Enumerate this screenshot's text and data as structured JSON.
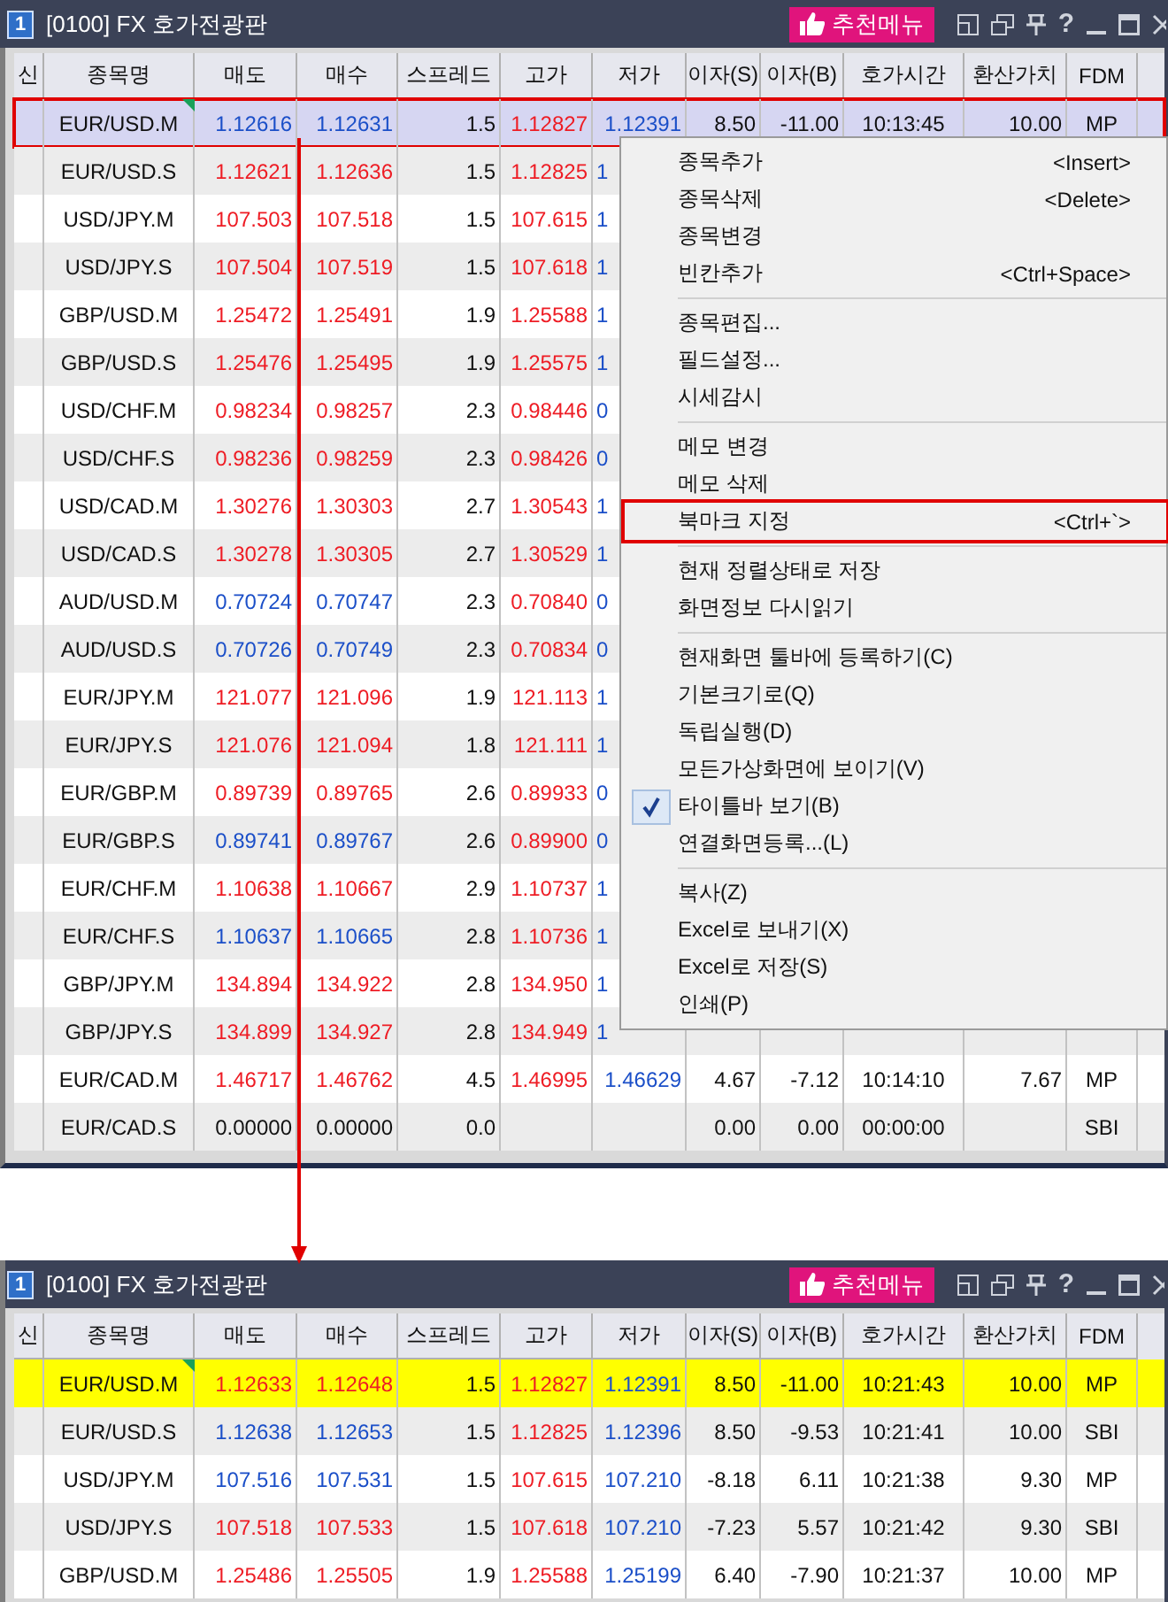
{
  "windows": [
    {
      "badge": "1",
      "title": "[0100] FX 호가전광판",
      "recommend": "추천메뉴",
      "help": "?",
      "columns": [
        "신",
        "종목명",
        "매도",
        "매수",
        "스프레드",
        "고가",
        "저가",
        "이자(S)",
        "이자(B)",
        "호가시간",
        "환산가치",
        "FDM"
      ],
      "rows": [
        {
          "selected": true,
          "bookmarked": false,
          "marked": true,
          "memo": true,
          "cells": [
            "",
            "EUR/USD.M",
            {
              "text": "1.12616",
              "color": "#1b4fc8"
            },
            {
              "text": "1.12631",
              "color": "#1b4fc8"
            },
            "1.5",
            {
              "text": "1.12827",
              "color": "#ee1c24"
            },
            {
              "text": "1.12391",
              "color": "#1b4fc8"
            },
            "8.50",
            "-11.00",
            "10:13:45",
            "10.00",
            "MP"
          ]
        },
        {
          "selected": false,
          "bookmarked": false,
          "marked": false,
          "memo": false,
          "cells": [
            "",
            "EUR/USD.S",
            {
              "text": "1.12621",
              "color": "#ee1c24"
            },
            {
              "text": "1.12636",
              "color": "#ee1c24"
            },
            "1.5",
            {
              "text": "1.12825",
              "color": "#ee1c24"
            },
            {
              "text": "1",
              "color": "#1b4fc8"
            }
          ]
        },
        {
          "selected": false,
          "bookmarked": false,
          "marked": false,
          "memo": false,
          "cells": [
            "",
            "USD/JPY.M",
            {
              "text": "107.503",
              "color": "#ee1c24"
            },
            {
              "text": "107.518",
              "color": "#ee1c24"
            },
            "1.5",
            {
              "text": "107.615",
              "color": "#ee1c24"
            },
            {
              "text": "1",
              "color": "#1b4fc8"
            }
          ]
        },
        {
          "selected": false,
          "bookmarked": false,
          "marked": false,
          "memo": false,
          "cells": [
            "",
            "USD/JPY.S",
            {
              "text": "107.504",
              "color": "#ee1c24"
            },
            {
              "text": "107.519",
              "color": "#ee1c24"
            },
            "1.5",
            {
              "text": "107.618",
              "color": "#ee1c24"
            },
            {
              "text": "1",
              "color": "#1b4fc8"
            }
          ]
        },
        {
          "selected": false,
          "bookmarked": false,
          "marked": false,
          "memo": false,
          "cells": [
            "",
            "GBP/USD.M",
            {
              "text": "1.25472",
              "color": "#ee1c24"
            },
            {
              "text": "1.25491",
              "color": "#ee1c24"
            },
            "1.9",
            {
              "text": "1.25588",
              "color": "#ee1c24"
            },
            {
              "text": "1",
              "color": "#1b4fc8"
            }
          ]
        },
        {
          "selected": false,
          "bookmarked": false,
          "marked": false,
          "memo": false,
          "cells": [
            "",
            "GBP/USD.S",
            {
              "text": "1.25476",
              "color": "#ee1c24"
            },
            {
              "text": "1.25495",
              "color": "#ee1c24"
            },
            "1.9",
            {
              "text": "1.25575",
              "color": "#ee1c24"
            },
            {
              "text": "1",
              "color": "#1b4fc8"
            }
          ]
        },
        {
          "selected": false,
          "bookmarked": false,
          "marked": false,
          "memo": false,
          "cells": [
            "",
            "USD/CHF.M",
            {
              "text": "0.98234",
              "color": "#ee1c24"
            },
            {
              "text": "0.98257",
              "color": "#ee1c24"
            },
            "2.3",
            {
              "text": "0.98446",
              "color": "#ee1c24"
            },
            {
              "text": "0",
              "color": "#1b4fc8"
            }
          ]
        },
        {
          "selected": false,
          "bookmarked": false,
          "marked": false,
          "memo": false,
          "cells": [
            "",
            "USD/CHF.S",
            {
              "text": "0.98236",
              "color": "#ee1c24"
            },
            {
              "text": "0.98259",
              "color": "#ee1c24"
            },
            "2.3",
            {
              "text": "0.98426",
              "color": "#ee1c24"
            },
            {
              "text": "0",
              "color": "#1b4fc8"
            }
          ]
        },
        {
          "selected": false,
          "bookmarked": false,
          "marked": false,
          "memo": false,
          "cells": [
            "",
            "USD/CAD.M",
            {
              "text": "1.30276",
              "color": "#ee1c24"
            },
            {
              "text": "1.30303",
              "color": "#ee1c24"
            },
            "2.7",
            {
              "text": "1.30543",
              "color": "#ee1c24"
            },
            {
              "text": "1",
              "color": "#1b4fc8"
            }
          ]
        },
        {
          "selected": false,
          "bookmarked": false,
          "marked": false,
          "memo": false,
          "cells": [
            "",
            "USD/CAD.S",
            {
              "text": "1.30278",
              "color": "#ee1c24"
            },
            {
              "text": "1.30305",
              "color": "#ee1c24"
            },
            "2.7",
            {
              "text": "1.30529",
              "color": "#ee1c24"
            },
            {
              "text": "1",
              "color": "#1b4fc8"
            }
          ]
        },
        {
          "selected": false,
          "bookmarked": false,
          "marked": false,
          "memo": false,
          "cells": [
            "",
            "AUD/USD.M",
            {
              "text": "0.70724",
              "color": "#1b4fc8"
            },
            {
              "text": "0.70747",
              "color": "#1b4fc8"
            },
            "2.3",
            {
              "text": "0.70840",
              "color": "#ee1c24"
            },
            {
              "text": "0",
              "color": "#1b4fc8"
            }
          ]
        },
        {
          "selected": false,
          "bookmarked": false,
          "marked": false,
          "memo": false,
          "cells": [
            "",
            "AUD/USD.S",
            {
              "text": "0.70726",
              "color": "#1b4fc8"
            },
            {
              "text": "0.70749",
              "color": "#1b4fc8"
            },
            "2.3",
            {
              "text": "0.70834",
              "color": "#ee1c24"
            },
            {
              "text": "0",
              "color": "#1b4fc8"
            }
          ]
        },
        {
          "selected": false,
          "bookmarked": false,
          "marked": false,
          "memo": false,
          "cells": [
            "",
            "EUR/JPY.M",
            {
              "text": "121.077",
              "color": "#ee1c24"
            },
            {
              "text": "121.096",
              "color": "#ee1c24"
            },
            "1.9",
            {
              "text": "121.113",
              "color": "#ee1c24"
            },
            {
              "text": "1",
              "color": "#1b4fc8"
            }
          ]
        },
        {
          "selected": false,
          "bookmarked": false,
          "marked": false,
          "memo": false,
          "cells": [
            "",
            "EUR/JPY.S",
            {
              "text": "121.076",
              "color": "#ee1c24"
            },
            {
              "text": "121.094",
              "color": "#ee1c24"
            },
            "1.8",
            {
              "text": "121.111",
              "color": "#ee1c24"
            },
            {
              "text": "1",
              "color": "#1b4fc8"
            }
          ]
        },
        {
          "selected": false,
          "bookmarked": false,
          "marked": false,
          "memo": false,
          "cells": [
            "",
            "EUR/GBP.M",
            {
              "text": "0.89739",
              "color": "#ee1c24"
            },
            {
              "text": "0.89765",
              "color": "#ee1c24"
            },
            "2.6",
            {
              "text": "0.89933",
              "color": "#ee1c24"
            },
            {
              "text": "0",
              "color": "#1b4fc8"
            }
          ]
        },
        {
          "selected": false,
          "bookmarked": false,
          "marked": false,
          "memo": false,
          "cells": [
            "",
            "EUR/GBP.S",
            {
              "text": "0.89741",
              "color": "#1b4fc8"
            },
            {
              "text": "0.89767",
              "color": "#1b4fc8"
            },
            "2.6",
            {
              "text": "0.89900",
              "color": "#ee1c24"
            },
            {
              "text": "0",
              "color": "#1b4fc8"
            }
          ]
        },
        {
          "selected": false,
          "bookmarked": false,
          "marked": false,
          "memo": false,
          "cells": [
            "",
            "EUR/CHF.M",
            {
              "text": "1.10638",
              "color": "#ee1c24"
            },
            {
              "text": "1.10667",
              "color": "#ee1c24"
            },
            "2.9",
            {
              "text": "1.10737",
              "color": "#ee1c24"
            },
            {
              "text": "1",
              "color": "#1b4fc8"
            }
          ]
        },
        {
          "selected": false,
          "bookmarked": false,
          "marked": false,
          "memo": false,
          "cells": [
            "",
            "EUR/CHF.S",
            {
              "text": "1.10637",
              "color": "#1b4fc8"
            },
            {
              "text": "1.10665",
              "color": "#1b4fc8"
            },
            "2.8",
            {
              "text": "1.10736",
              "color": "#ee1c24"
            },
            {
              "text": "1",
              "color": "#1b4fc8"
            }
          ]
        },
        {
          "selected": false,
          "bookmarked": false,
          "marked": false,
          "memo": false,
          "cells": [
            "",
            "GBP/JPY.M",
            {
              "text": "134.894",
              "color": "#ee1c24"
            },
            {
              "text": "134.922",
              "color": "#ee1c24"
            },
            "2.8",
            {
              "text": "134.950",
              "color": "#ee1c24"
            },
            {
              "text": "1",
              "color": "#1b4fc8"
            }
          ]
        },
        {
          "selected": false,
          "bookmarked": false,
          "marked": false,
          "memo": false,
          "cells": [
            "",
            "GBP/JPY.S",
            {
              "text": "134.899",
              "color": "#ee1c24"
            },
            {
              "text": "134.927",
              "color": "#ee1c24"
            },
            "2.8",
            {
              "text": "134.949",
              "color": "#ee1c24"
            },
            {
              "text": "1",
              "color": "#1b4fc8"
            }
          ]
        },
        {
          "selected": false,
          "bookmarked": false,
          "marked": false,
          "memo": false,
          "cells": [
            "",
            "EUR/CAD.M",
            {
              "text": "1.46717",
              "color": "#ee1c24"
            },
            {
              "text": "1.46762",
              "color": "#ee1c24"
            },
            "4.5",
            {
              "text": "1.46995",
              "color": "#ee1c24"
            },
            {
              "text": "1.46629",
              "color": "#1b4fc8"
            },
            "4.67",
            "-7.12",
            "10:14:10",
            "7.67",
            "MP"
          ]
        },
        {
          "selected": false,
          "bookmarked": false,
          "marked": false,
          "memo": false,
          "cells": [
            "",
            "EUR/CAD.S",
            "0.00000",
            "0.00000",
            "0.0",
            "",
            "",
            "0.00",
            "0.00",
            "00:00:00",
            "",
            "SBI"
          ]
        }
      ],
      "menu": {
        "groups": [
          [
            {
              "label": "종목추가",
              "shortcut": "<Insert>",
              "checked": false,
              "marked": false
            },
            {
              "label": "종목삭제",
              "shortcut": "<Delete>",
              "checked": false,
              "marked": false
            },
            {
              "label": "종목변경",
              "checked": false,
              "marked": false
            },
            {
              "label": "빈칸추가",
              "shortcut": "<Ctrl+Space>",
              "checked": false,
              "marked": false
            }
          ],
          [
            {
              "label": "종목편집...",
              "checked": false,
              "marked": false
            },
            {
              "label": "필드설정...",
              "checked": false,
              "marked": false
            },
            {
              "label": "시세감시",
              "checked": false,
              "marked": false
            }
          ],
          [
            {
              "label": "메모 변경",
              "checked": false,
              "marked": false
            },
            {
              "label": "메모 삭제",
              "checked": false,
              "marked": false
            },
            {
              "label": "북마크 지정",
              "shortcut": "<Ctrl+`>",
              "checked": false,
              "marked": true
            }
          ],
          [
            {
              "label": "현재 정렬상태로 저장",
              "checked": false,
              "marked": false
            },
            {
              "label": "화면정보 다시읽기",
              "checked": false,
              "marked": false
            }
          ],
          [
            {
              "label": "현재화면 툴바에 등록하기(C)",
              "checked": false,
              "marked": false
            },
            {
              "label": "기본크기로(Q)",
              "checked": false,
              "marked": false
            },
            {
              "label": "독립실행(D)",
              "checked": false,
              "marked": false
            },
            {
              "label": "모든가상화면에 보이기(V)",
              "checked": false,
              "marked": false
            },
            {
              "label": "타이틀바 보기(B)",
              "checked": true,
              "marked": false
            },
            {
              "label": "연결화면등록...(L)",
              "checked": false,
              "marked": false
            }
          ],
          [
            {
              "label": "복사(Z)",
              "checked": false,
              "marked": false
            },
            {
              "label": "Excel로 보내기(X)",
              "checked": false,
              "marked": false
            },
            {
              "label": "Excel로 저장(S)",
              "checked": false,
              "marked": false
            },
            {
              "label": "인쇄(P)",
              "checked": false,
              "marked": false
            }
          ]
        ]
      }
    },
    {
      "badge": "1",
      "title": "[0100] FX 호가전광판",
      "recommend": "추천메뉴",
      "help": "?",
      "columns": [
        "신",
        "종목명",
        "매도",
        "매수",
        "스프레드",
        "고가",
        "저가",
        "이자(S)",
        "이자(B)",
        "호가시간",
        "환산가치",
        "FDM"
      ],
      "rows": [
        {
          "selected": false,
          "bookmarked": true,
          "marked": false,
          "memo": true,
          "cells": [
            "",
            "EUR/USD.M",
            {
              "text": "1.12633",
              "color": "#ee1c24"
            },
            {
              "text": "1.12648",
              "color": "#ee1c24"
            },
            "1.5",
            {
              "text": "1.12827",
              "color": "#ee1c24"
            },
            {
              "text": "1.12391",
              "color": "#1b4fc8"
            },
            "8.50",
            "-11.00",
            "10:21:43",
            "10.00",
            "MP"
          ]
        },
        {
          "selected": false,
          "bookmarked": false,
          "marked": false,
          "memo": false,
          "cells": [
            "",
            "EUR/USD.S",
            {
              "text": "1.12638",
              "color": "#1b4fc8"
            },
            {
              "text": "1.12653",
              "color": "#1b4fc8"
            },
            "1.5",
            {
              "text": "1.12825",
              "color": "#ee1c24"
            },
            {
              "text": "1.12396",
              "color": "#1b4fc8"
            },
            "8.50",
            "-9.53",
            "10:21:41",
            "10.00",
            "SBI"
          ]
        },
        {
          "selected": false,
          "bookmarked": false,
          "marked": false,
          "memo": false,
          "cells": [
            "",
            "USD/JPY.M",
            {
              "text": "107.516",
              "color": "#1b4fc8"
            },
            {
              "text": "107.531",
              "color": "#1b4fc8"
            },
            "1.5",
            {
              "text": "107.615",
              "color": "#ee1c24"
            },
            {
              "text": "107.210",
              "color": "#1b4fc8"
            },
            "-8.18",
            "6.11",
            "10:21:38",
            "9.30",
            "MP"
          ]
        },
        {
          "selected": false,
          "bookmarked": false,
          "marked": false,
          "memo": false,
          "cells": [
            "",
            "USD/JPY.S",
            {
              "text": "107.518",
              "color": "#ee1c24"
            },
            {
              "text": "107.533",
              "color": "#ee1c24"
            },
            "1.5",
            {
              "text": "107.618",
              "color": "#ee1c24"
            },
            {
              "text": "107.210",
              "color": "#1b4fc8"
            },
            "-7.23",
            "5.57",
            "10:21:42",
            "9.30",
            "SBI"
          ]
        },
        {
          "selected": false,
          "bookmarked": false,
          "marked": false,
          "memo": false,
          "cells": [
            "",
            "GBP/USD.M",
            {
              "text": "1.25486",
              "color": "#ee1c24"
            },
            {
              "text": "1.25505",
              "color": "#ee1c24"
            },
            "1.9",
            {
              "text": "1.25588",
              "color": "#ee1c24"
            },
            {
              "text": "1.25199",
              "color": "#1b4fc8"
            },
            "6.40",
            "-7.90",
            "10:21:37",
            "10.00",
            "MP"
          ]
        }
      ]
    }
  ]
}
